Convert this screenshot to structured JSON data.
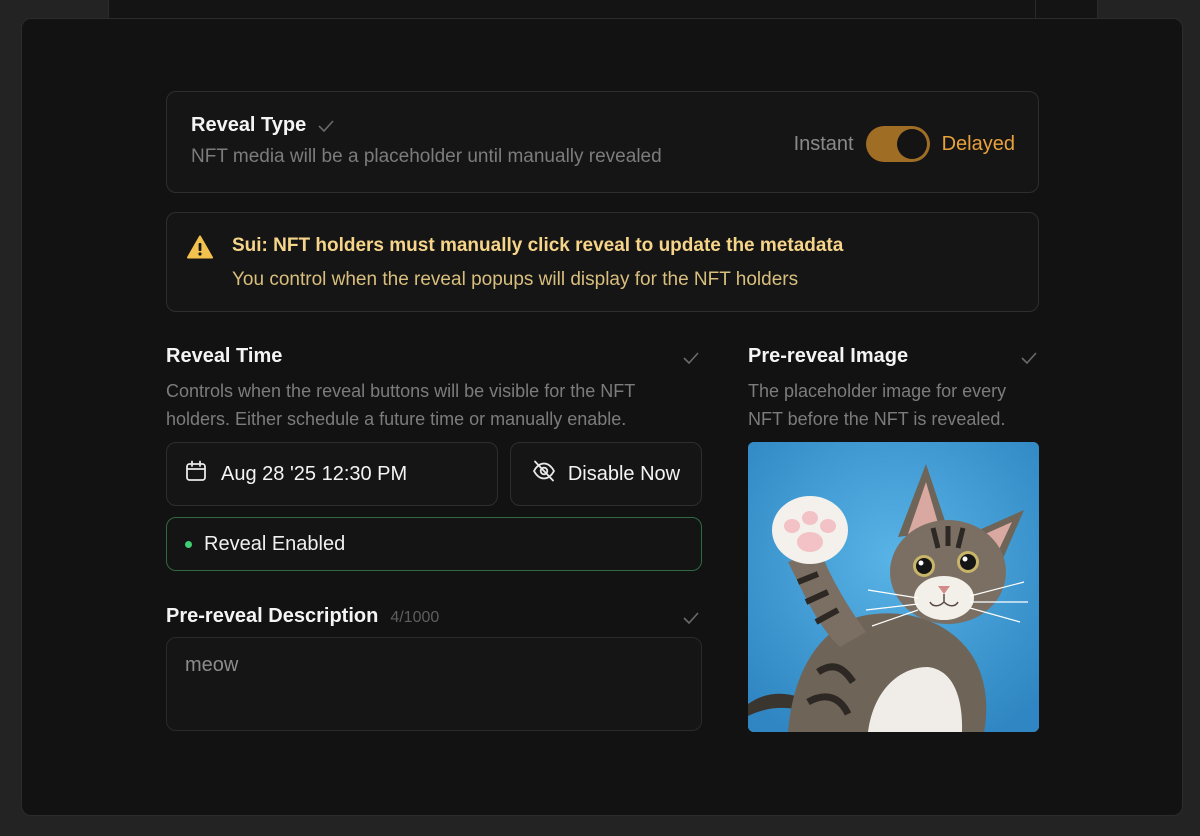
{
  "reveal_type": {
    "title": "Reveal Type",
    "subtitle": "NFT media will be a placeholder until manually revealed",
    "option_off": "Instant",
    "option_on": "Delayed",
    "delayed": true
  },
  "warning": {
    "title": "Sui: NFT holders must manually click reveal to update the metadata",
    "subtitle": "You control when the reveal popups will display for the NFT holders"
  },
  "reveal_time": {
    "title": "Reveal Time",
    "description_line1": "Controls when the reveal buttons will be visible for the NFT",
    "description_line2": "holders. Either schedule a future time or manually enable.",
    "date_value": "Aug 28 '25 12:30 PM",
    "disable_label": "Disable Now",
    "status": "Reveal Enabled"
  },
  "pre_reveal_description": {
    "title": "Pre-reveal Description",
    "counter": "4/1000",
    "value": "meow"
  },
  "pre_reveal_image": {
    "title": "Pre-reveal Image",
    "description_line1": "The placeholder image for every",
    "description_line2": "NFT before the NFT is revealed."
  },
  "colors": {
    "accent": "#e9a13b",
    "toggle_track": "#a06d25",
    "warning_text": "#f6d58a",
    "status_border": "#2f6a45",
    "status_dot": "#3ecf74",
    "image_background": "#3e9ad2"
  }
}
